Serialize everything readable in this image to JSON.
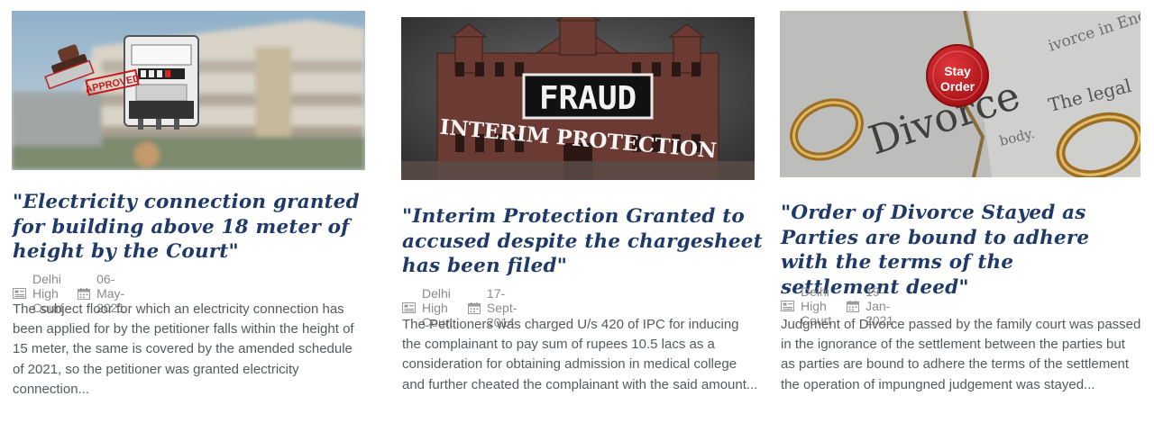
{
  "cards": [
    {
      "title": "\"Electricity connection granted for building above 18 meter of height by the Court\"",
      "court": "Delhi High Court",
      "date": "06-May-2021",
      "excerpt": "The subject floor for which an electricity connection has been applied for by the petitioner falls within the height of 15 meter, the same is covered by the amended schedule of 2021, so the petitioner was granted electricity connection...",
      "image": {
        "stamp_text": "APPROVED"
      }
    },
    {
      "title": "\"Interim Protection Granted to accused despite the chargesheet has been filed\"",
      "court": "Delhi High Court",
      "date": "17-Sept-2014",
      "excerpt": "The Petitioners was charged U/s 420 of IPC for inducing the complainant to pay sum of rupees 10.5 lacs as a consideration for obtaining admission in medical college and further cheated the complainant with the said amount...",
      "image": {
        "line1": "FRAUD",
        "line2": "INTERIM PROTECTION"
      }
    },
    {
      "title": "\"Order of Divorce Stayed as Parties are bound to adhere with the terms of the settlement deed\"",
      "court": "Delhi High Court",
      "date": "19-Jan-2021",
      "excerpt": "Judgment of Divorce passed by the family court was passed in the ignorance of the settlement between the parties but as parties are bound to adhere the terms of the settlement the operation of impungned judgement was stayed...",
      "image": {
        "seal_line1": "Stay",
        "seal_line2": "Order",
        "paper_word": "Divorce",
        "paper_text1": "ivorce in English",
        "paper_text2": "The legal",
        "paper_text3": "body."
      }
    }
  ],
  "icons": {
    "court": "newspaper-icon",
    "date": "calendar-icon"
  },
  "colors": {
    "title": "#1f3a68",
    "meta": "#8a8a8a",
    "excerpt": "#555a5f",
    "seal": "#c3161b"
  }
}
